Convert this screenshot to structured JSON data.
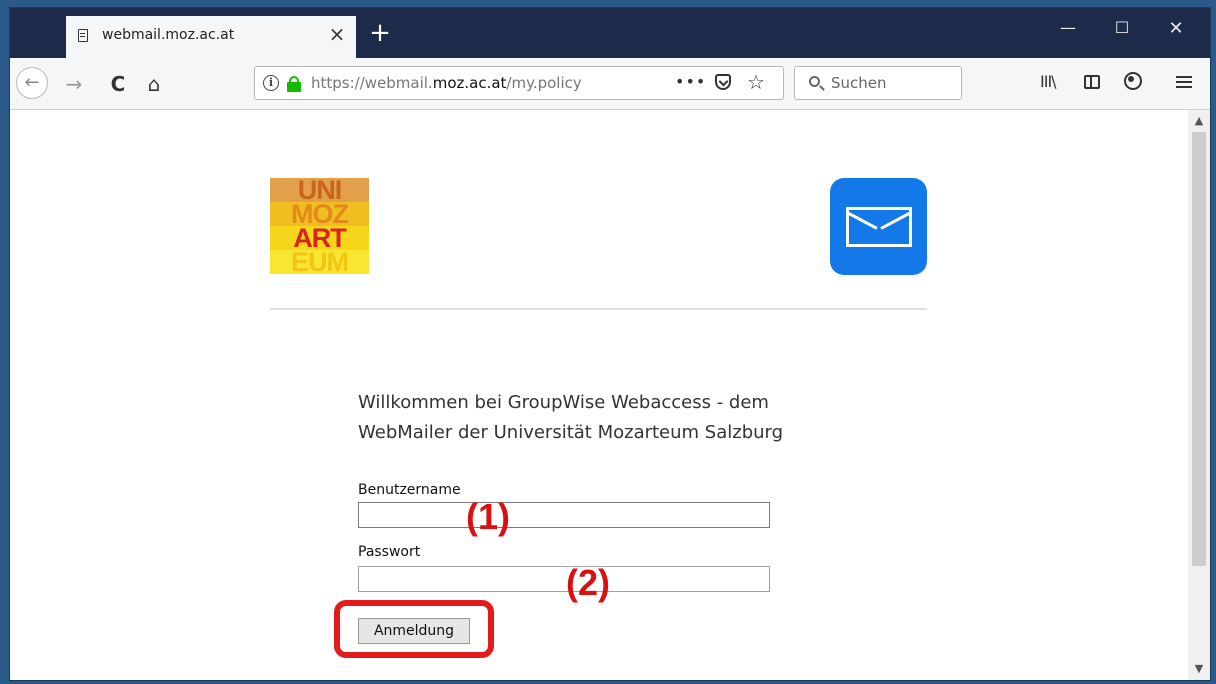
{
  "tab": {
    "title": "webmail.moz.ac.at",
    "close_glyph": "×",
    "new_tab_glyph": "+"
  },
  "window_controls": {
    "minimize": "—",
    "maximize": "☐",
    "close": "✕"
  },
  "navbar": {
    "back_glyph": "←",
    "forward_glyph": "→",
    "reload_glyph": "C",
    "home_glyph": "⌂",
    "url_prefix": "https://webmail.",
    "url_domain": "moz.ac.at",
    "url_path": "/my.policy",
    "page_actions_glyph": "•••",
    "star_glyph": "☆",
    "search_placeholder": "Suchen",
    "library_glyph": "III\\"
  },
  "scrollbar": {
    "up_glyph": "▲",
    "down_glyph": "▼"
  },
  "logo": {
    "rows": [
      "UNI",
      "MOZ",
      "ART",
      "EUM"
    ]
  },
  "content": {
    "welcome_line1": "Willkommen bei GroupWise Webaccess - dem",
    "welcome_line2": "WebMailer der Universität Mozarteum Salzburg",
    "username_label": "Benutzername",
    "password_label": "Passwort",
    "login_button": "Anmeldung",
    "annotation_1": "(1)",
    "annotation_2": "(2)"
  },
  "colors": {
    "accent_blue": "#1379e8",
    "secure_green": "#12bc00",
    "annotation_red": "#e31b1b",
    "tabbar": "#1e2a4a"
  }
}
